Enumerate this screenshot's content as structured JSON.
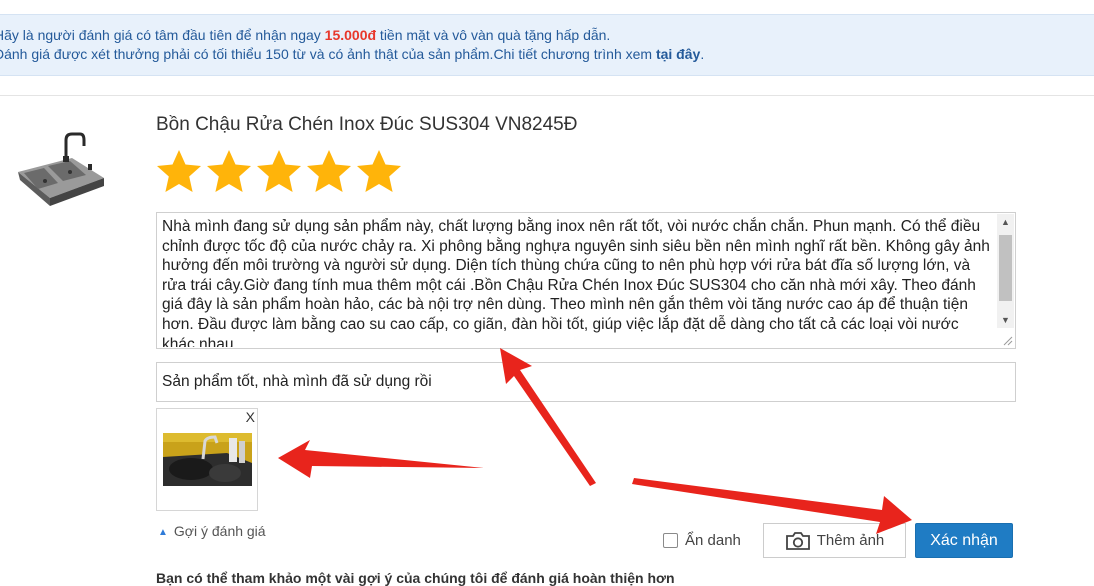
{
  "banner": {
    "line1_prefix": "Hãy là người đánh giá có tâm đầu tiên để nhận ngay ",
    "line1_amount": "15.000đ",
    "line1_suffix": " tiền mặt và vô vàn quà tặng hấp dẫn.",
    "line2_prefix": "Đánh giá được xét thưởng phải có tối thiểu 150 từ và có ảnh thật của sản phẩm.Chi tiết chương trình xem ",
    "line2_link": "tại đây",
    "line2_suffix": "."
  },
  "product": {
    "title": "Bồn Chậu Rửa Chén Inox Đúc SUS304 VN8245Đ",
    "rating": 5,
    "rating_max": 5
  },
  "review": {
    "content": "Nhà mình đang sử dụng sản phẩm này, chất lượng bằng inox nên rất tốt, vòi nước chắn chắn. Phun mạnh. Có thể điều chỉnh được tốc độ của nước chảy ra.  Xi phông bằng nghựa nguyên sinh siêu bền nên mình nghĩ rất bền. Không gây ảnh hưởng đến môi trường và người sử dụng. Diện tích thùng chứa cũng to nên phù hợp với rửa bát đĩa số lượng lớn, và rửa trái cây.Giờ đang tính mua thêm một cái .Bồn Chậu Rửa Chén Inox Đúc SUS304 cho căn nhà mới xây. Theo đánh giá đây là sản phẩm hoàn hảo, các bà nội trợ nên dùng. Theo mình nên gắn thêm vòi tăng nước cao áp để thuận tiện hơn. Đầu được làm bằng cao su cao cấp, co giãn, đàn hồi tốt, giúp việc lắp đặt dễ dàng cho tất cả các loại vòi nước khác nhau.",
    "title_value": "Sản phẩm tốt, nhà mình đã sử dụng rồi"
  },
  "photo": {
    "remove_label": "X"
  },
  "actions": {
    "suggest_label": "Gợi ý đánh giá",
    "anonymous_label": "Ẩn danh",
    "anonymous_checked": false,
    "add_photo_label": "Thêm ảnh",
    "confirm_label": "Xác nhận"
  },
  "footer": {
    "hint": "Bạn có thể tham khảo một vài gợi ý của chúng tôi để đánh giá hoàn thiện hơn"
  },
  "colors": {
    "banner_bg": "#e8f1fb",
    "banner_text": "#245a9a",
    "amount": "#e8372b",
    "star": "#ffb40a",
    "confirm_bg": "#1f7cc4",
    "arrow": "#e8241c"
  },
  "icons": {
    "stars": "star-icon",
    "camera": "camera-icon",
    "suggest_caret": "caret-up-icon"
  }
}
